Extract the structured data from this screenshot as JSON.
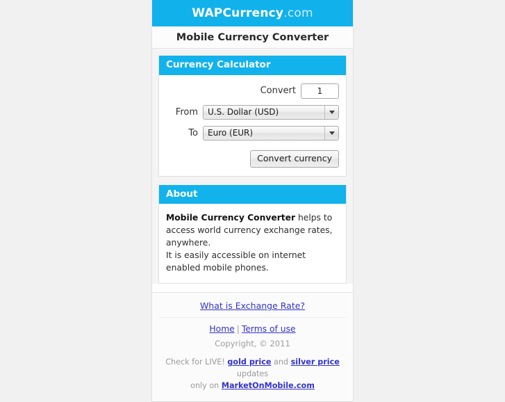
{
  "masthead": {
    "brand": "WAPCurrency",
    "tld": ".com",
    "subtitle": "Mobile Currency Converter",
    "background_color": "#11b1ec"
  },
  "calculator": {
    "panel_title": "Currency Calculator",
    "amount_label": "Convert",
    "amount_value": "1",
    "amount_placeholder": "",
    "from_label": "From",
    "from_value": "U.S. Dollar (USD)",
    "to_label": "To",
    "to_value": "Euro (EUR)",
    "submit_label": "Convert currency"
  },
  "about": {
    "panel_title": "About",
    "lead": "Mobile Currency Converter",
    "body_part_1": " helps to access world currency exchange rates, anywhere.",
    "body_part_2": "It is easily accessible on internet enabled mobile phones."
  },
  "footer": {
    "exchange_rate_link": "What is Exchange Rate?",
    "home_link": "Home",
    "separator": "|",
    "terms_link": "Terms of use",
    "copyright": "Copyright, © 2011",
    "promo_prefix": "Check for LIVE!",
    "promo_gold": "gold price",
    "promo_and": "and",
    "promo_silver": "silver price",
    "promo_suffix": "updates",
    "promo_only_on": "only on",
    "promo_site": "MarketOnMobile.com"
  },
  "theme": {
    "accent": "#12b2ec",
    "link": "#3333cc",
    "page_background": "#f1f1f1"
  }
}
